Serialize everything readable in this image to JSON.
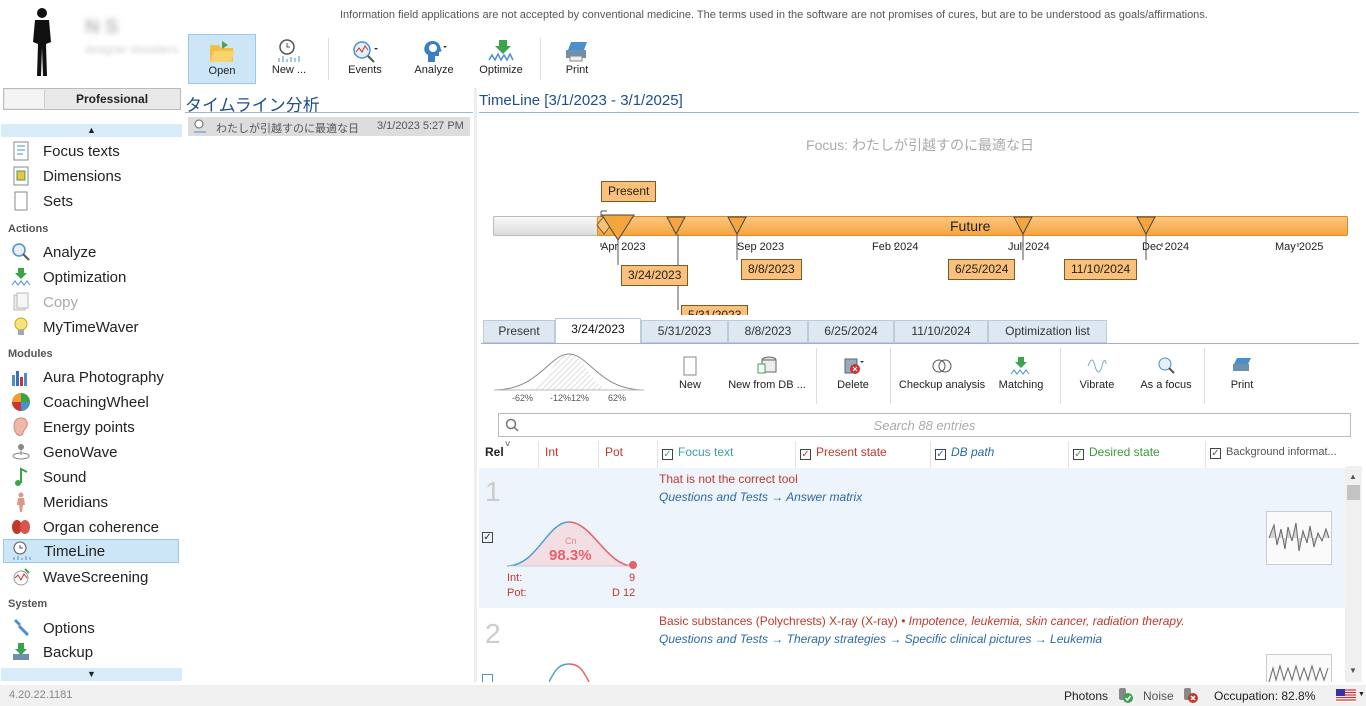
{
  "disclaimer": "Information field applications are not accepted by conventional medicine. The terms used in the software are not promises of cures, but are to be understood as goals/affirmations.",
  "user": {
    "name": "N S",
    "sub": "designer shoulders"
  },
  "toolbar": [
    {
      "label": "Open",
      "icon": "folder-open-icon"
    },
    {
      "label": "New ...",
      "icon": "timeline-new-icon"
    },
    {
      "label": "Events",
      "icon": "events-icon"
    },
    {
      "label": "Analyze",
      "icon": "analyze-head-icon"
    },
    {
      "label": "Optimize",
      "icon": "optimize-icon"
    },
    {
      "label": "Print",
      "icon": "printer-icon"
    }
  ],
  "profile": "Professional",
  "nav": {
    "items": [
      "Focus texts",
      "Dimensions",
      "Sets"
    ],
    "actions_header": "Actions",
    "actions": [
      "Analyze",
      "Optimization",
      "Copy",
      "MyTimeWaver"
    ],
    "modules_header": "Modules",
    "modules": [
      "Aura Photography",
      "CoachingWheel",
      "Energy points",
      "GenoWave",
      "Sound",
      "Meridians",
      "Organ coherence",
      "TimeLine",
      "WaveScreening"
    ],
    "system_header": "System",
    "system": [
      "Options",
      "Backup"
    ]
  },
  "middle": {
    "title": "タイムライン分析",
    "item": {
      "name": "わたしが引越すのに最適な日",
      "date": "3/1/2023 5:27 PM"
    }
  },
  "timeline": {
    "title": "TimeLine [3/1/2023 - 3/1/2025]",
    "focus": "Focus: わたしが引越すのに最適な日",
    "present": "Present",
    "future": "Future",
    "ticks": [
      "Apr 2023",
      "Sep 2023",
      "Feb 2024",
      "Jul 2024",
      "Dec 2024",
      "May 2025"
    ],
    "events": [
      "3/24/2023",
      "8/8/2023",
      "6/25/2024",
      "11/10/2024",
      "5/31/2023"
    ]
  },
  "tabs": [
    "Present",
    "3/24/2023",
    "5/31/2023",
    "8/8/2023",
    "6/25/2024",
    "11/10/2024",
    "Optimization list"
  ],
  "dist": {
    "labels": [
      "-62%",
      "-12%",
      "12%",
      "62%"
    ]
  },
  "actions": [
    "New",
    "New from DB ...",
    "Delete",
    "Checkup analysis",
    "Matching",
    "Vibrate",
    "As a focus",
    "Print"
  ],
  "search_placeholder": "Search 88 entries",
  "columns": {
    "rel": "Rel",
    "int": "Int",
    "pot": "Pot",
    "focus": "Focus text",
    "present": "Present state",
    "db": "DB path",
    "desired": "Desired state",
    "background": "Background informat..."
  },
  "colors": {
    "accent": "#1f4e89",
    "orange": "#f5a53e",
    "red": "#c0392b",
    "pink": "#e8606a"
  },
  "rows": [
    {
      "num": "1",
      "title": "That is not the correct tool",
      "extra": "",
      "path": "Questions and Tests → Answer matrix",
      "cn": "Cn",
      "pct": "98.3%",
      "int_label": "Int:",
      "int_val": "9",
      "pot_label": "Pot:",
      "pot_val": "D 12"
    },
    {
      "num": "2",
      "title": "Basic substances (Polychrests) X-ray (X-ray)",
      "extra": "• Impotence, leukemia, skin cancer, radiation therapy.",
      "path": "Questions and Tests → Therapy strategies → Specific clinical pictures → Leukemia"
    }
  ],
  "status": {
    "version": "4.20.22.1181",
    "photons": "Photons",
    "noise": "Noise",
    "occupation": "Occupation: 82.8%"
  }
}
